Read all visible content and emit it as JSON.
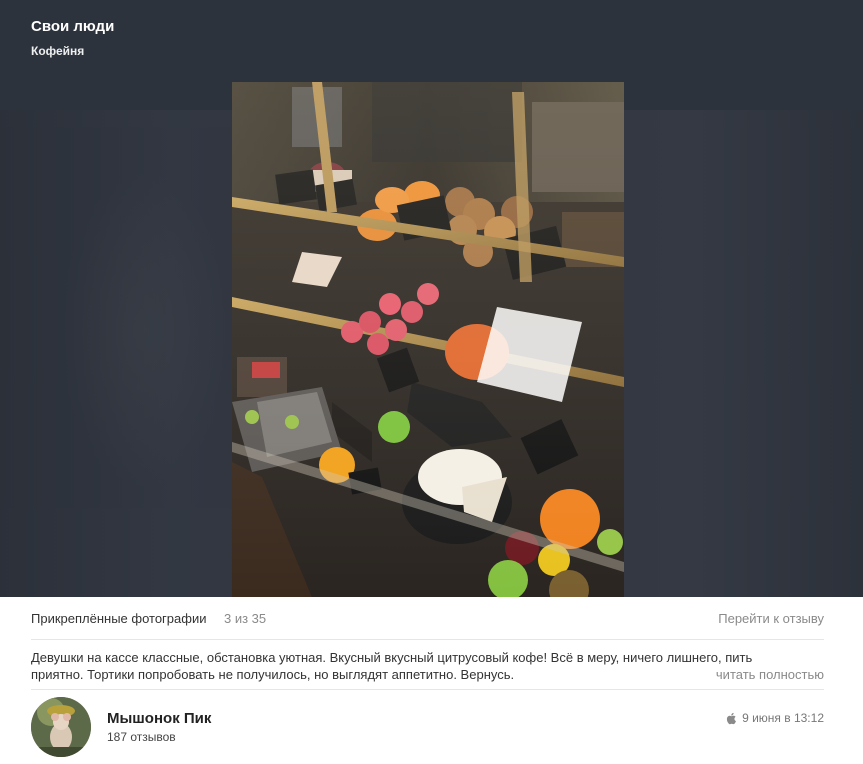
{
  "place": {
    "name": "Свои люди",
    "type": "Кофейня"
  },
  "photo": {
    "description_icon": "photo"
  },
  "attached": {
    "label": "Прикреплённые фотографии",
    "count": "3 из 35",
    "goto_label": "Перейти к отзыву"
  },
  "review": {
    "text": "Девушки на кассе классные, обстановка уютная. Вкусный вкусный цитрусовый кофе! Всё в меру, ничего лишнего, пить приятно. Тортики попробовать не получилось, но выглядят аппетитно. Вернусь.",
    "more_label": "читать полностью"
  },
  "author": {
    "name": "Мышонок Пик",
    "reviews_count": "187 отзывов",
    "date": "9 июня в 13:12",
    "platform_icon": "apple-icon"
  }
}
